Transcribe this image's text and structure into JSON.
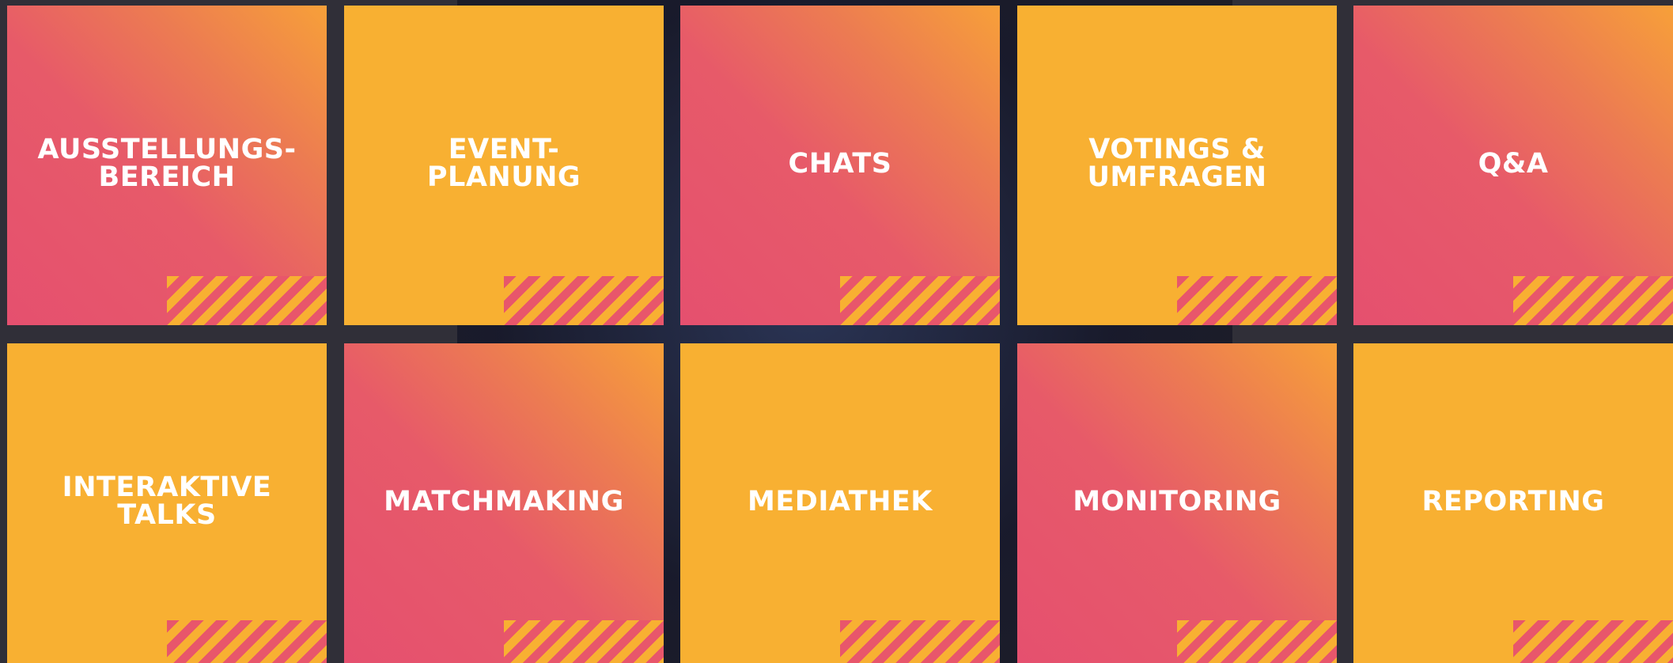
{
  "colors": {
    "pink": "#e75a69",
    "orange": "#f8b032",
    "gutter": "#302f38"
  },
  "tiles": [
    {
      "label": "AUSSTELLUNGS-\nBEREICH",
      "style": "pink"
    },
    {
      "label": "EVENT-\nPLANUNG",
      "style": "orange"
    },
    {
      "label": "CHATS",
      "style": "pink"
    },
    {
      "label": "VOTINGS &\nUMFRAGEN",
      "style": "orange"
    },
    {
      "label": "Q&A",
      "style": "pink"
    },
    {
      "label": "INTERAKTIVE\nTALKS",
      "style": "orange"
    },
    {
      "label": "MATCHMAKING",
      "style": "pink"
    },
    {
      "label": "MEDIATHEK",
      "style": "orange"
    },
    {
      "label": "MONITORING",
      "style": "pink"
    },
    {
      "label": "REPORTING",
      "style": "orange"
    }
  ]
}
